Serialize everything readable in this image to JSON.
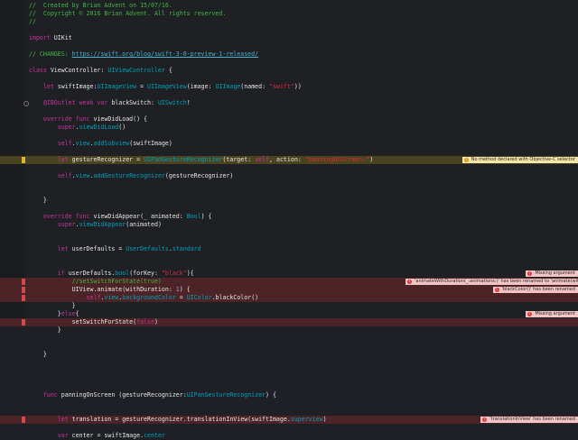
{
  "editor": {
    "lines": [
      {
        "parts": [
          {
            "c": "c",
            "t": "//  Created by Brian Advent on 15/07/16."
          }
        ]
      },
      {
        "parts": [
          {
            "c": "c",
            "t": "//  Copyright © 2016 Brian Advent. All rights reserved."
          }
        ]
      },
      {
        "parts": [
          {
            "c": "c",
            "t": "//"
          }
        ]
      },
      {
        "parts": []
      },
      {
        "parts": [
          {
            "c": "k",
            "t": "import"
          },
          {
            "c": "w",
            "t": " UIKit"
          }
        ]
      },
      {
        "parts": []
      },
      {
        "parts": [
          {
            "c": "c",
            "t": "// CHANGES: "
          },
          {
            "c": "lnk",
            "t": "https://swift.org/blog/swift-3-0-preview-1-released/"
          }
        ]
      },
      {
        "parts": []
      },
      {
        "parts": [
          {
            "c": "k",
            "t": "class"
          },
          {
            "c": "w",
            "t": " ViewController: "
          },
          {
            "c": "t",
            "t": "UIViewController"
          },
          {
            "c": "w",
            "t": " {"
          }
        ]
      },
      {
        "parts": []
      },
      {
        "parts": [
          {
            "c": "w",
            "t": "    "
          },
          {
            "c": "k",
            "t": "let"
          },
          {
            "c": "w",
            "t": " swiftImage:"
          },
          {
            "c": "t",
            "t": "UIImageView"
          },
          {
            "c": "w",
            "t": " = "
          },
          {
            "c": "t",
            "t": "UIImageView"
          },
          {
            "c": "w",
            "t": "(image: "
          },
          {
            "c": "t",
            "t": "UIImage"
          },
          {
            "c": "w",
            "t": "(named: "
          },
          {
            "c": "s",
            "t": "\"swift\""
          },
          {
            "c": "w",
            "t": "))"
          }
        ]
      },
      {
        "parts": []
      },
      {
        "parts": [
          {
            "c": "w",
            "t": "    "
          },
          {
            "c": "k",
            "t": "@IBOutlet weak var"
          },
          {
            "c": "w",
            "t": " blackSwitch: "
          },
          {
            "c": "t",
            "t": "UISwitch"
          },
          {
            "c": "w",
            "t": "!"
          }
        ],
        "dot": true
      },
      {
        "parts": []
      },
      {
        "parts": [
          {
            "c": "w",
            "t": "    "
          },
          {
            "c": "k",
            "t": "override func"
          },
          {
            "c": "w",
            "t": " viewDidLoad() {"
          }
        ]
      },
      {
        "parts": [
          {
            "c": "w",
            "t": "        "
          },
          {
            "c": "k",
            "t": "super"
          },
          {
            "c": "w",
            "t": "."
          },
          {
            "c": "t",
            "t": "viewDidLoad"
          },
          {
            "c": "w",
            "t": "()"
          }
        ]
      },
      {
        "parts": []
      },
      {
        "parts": [
          {
            "c": "w",
            "t": "        "
          },
          {
            "c": "k",
            "t": "self"
          },
          {
            "c": "w",
            "t": "."
          },
          {
            "c": "t",
            "t": "view"
          },
          {
            "c": "w",
            "t": "."
          },
          {
            "c": "t",
            "t": "addSubview"
          },
          {
            "c": "w",
            "t": "(swiftImage)"
          }
        ]
      },
      {
        "parts": []
      },
      {
        "parts": [
          {
            "c": "w",
            "t": "        "
          },
          {
            "c": "k",
            "t": "let"
          },
          {
            "c": "w",
            "t": " gestureRecognizer = "
          },
          {
            "c": "t",
            "t": "UIPanGestureRecognizer"
          },
          {
            "c": "w",
            "t": "(target: "
          },
          {
            "c": "k",
            "t": "self"
          },
          {
            "c": "w",
            "t": ", action: "
          },
          {
            "c": "s",
            "t": "\"panningOnScreen:\""
          },
          {
            "c": "w",
            "t": ")"
          }
        ],
        "hl": "warn",
        "marker": "warn"
      },
      {
        "parts": []
      },
      {
        "parts": [
          {
            "c": "w",
            "t": "        "
          },
          {
            "c": "k",
            "t": "self"
          },
          {
            "c": "w",
            "t": "."
          },
          {
            "c": "t",
            "t": "view"
          },
          {
            "c": "w",
            "t": "."
          },
          {
            "c": "t",
            "t": "addGestureRecognizer"
          },
          {
            "c": "w",
            "t": "(gestureRecognizer)"
          }
        ]
      },
      {
        "parts": []
      },
      {
        "parts": []
      },
      {
        "parts": [
          {
            "c": "w",
            "t": "    }"
          }
        ]
      },
      {
        "parts": []
      },
      {
        "parts": [
          {
            "c": "w",
            "t": "    "
          },
          {
            "c": "k",
            "t": "override func"
          },
          {
            "c": "w",
            "t": " viewDidAppear(_ animated: "
          },
          {
            "c": "t",
            "t": "Bool"
          },
          {
            "c": "w",
            "t": ") {"
          }
        ]
      },
      {
        "parts": [
          {
            "c": "w",
            "t": "        "
          },
          {
            "c": "k",
            "t": "super"
          },
          {
            "c": "w",
            "t": "."
          },
          {
            "c": "t",
            "t": "viewDidAppear"
          },
          {
            "c": "w",
            "t": "(animated)"
          }
        ]
      },
      {
        "parts": []
      },
      {
        "parts": []
      },
      {
        "parts": [
          {
            "c": "w",
            "t": "        "
          },
          {
            "c": "k",
            "t": "let"
          },
          {
            "c": "w",
            "t": " userDefaults = "
          },
          {
            "c": "t",
            "t": "UserDefaults"
          },
          {
            "c": "w",
            "t": "."
          },
          {
            "c": "t",
            "t": "standard"
          }
        ]
      },
      {
        "parts": []
      },
      {
        "parts": []
      },
      {
        "parts": [
          {
            "c": "w",
            "t": "        "
          },
          {
            "c": "k",
            "t": "if"
          },
          {
            "c": "w",
            "t": " userDefaults."
          },
          {
            "c": "t",
            "t": "bool"
          },
          {
            "c": "w",
            "t": "(forKey: "
          },
          {
            "c": "s",
            "t": "\"black\""
          },
          {
            "c": "w",
            "t": "){"
          }
        ]
      },
      {
        "parts": [
          {
            "c": "c",
            "t": "            //setSwitchForState(true)"
          }
        ],
        "hl": "err",
        "marker": "err"
      },
      {
        "parts": [
          {
            "c": "w",
            "t": "            UIView.animate(withDuration: "
          },
          {
            "c": "m",
            "t": "1"
          },
          {
            "c": "w",
            "t": ") {"
          }
        ],
        "hl": "err",
        "marker": "err"
      },
      {
        "parts": [
          {
            "c": "w",
            "t": "                "
          },
          {
            "c": "k",
            "t": "self"
          },
          {
            "c": "w",
            "t": "."
          },
          {
            "c": "t",
            "t": "view"
          },
          {
            "c": "w",
            "t": "."
          },
          {
            "c": "t",
            "t": "backgroundColor"
          },
          {
            "c": "w",
            "t": " = "
          },
          {
            "c": "t",
            "t": "UIColor"
          },
          {
            "c": "w",
            "t": ".blackColor()"
          }
        ],
        "hl": "err",
        "marker": "err"
      },
      {
        "parts": [
          {
            "c": "w",
            "t": "            }"
          }
        ]
      },
      {
        "parts": [
          {
            "c": "w",
            "t": "        }"
          },
          {
            "c": "k",
            "t": "else"
          },
          {
            "c": "w",
            "t": "{"
          }
        ]
      },
      {
        "parts": [
          {
            "c": "w",
            "t": "            setSwitchForState("
          },
          {
            "c": "k",
            "t": "false"
          },
          {
            "c": "w",
            "t": ")"
          }
        ],
        "hl": "err",
        "marker": "err"
      },
      {
        "parts": [
          {
            "c": "w",
            "t": "        }"
          }
        ]
      },
      {
        "parts": []
      },
      {
        "parts": []
      },
      {
        "parts": [
          {
            "c": "w",
            "t": "    }"
          }
        ]
      },
      {
        "parts": []
      },
      {
        "parts": []
      },
      {
        "parts": []
      },
      {
        "parts": []
      },
      {
        "parts": [
          {
            "c": "w",
            "t": "    "
          },
          {
            "c": "k",
            "t": "func"
          },
          {
            "c": "w",
            "t": " panningOnScreen (gestureRecognizer:"
          },
          {
            "c": "t",
            "t": "UIPanGestureRecognizer"
          },
          {
            "c": "w",
            "t": ") {"
          }
        ]
      },
      {
        "parts": []
      },
      {
        "parts": []
      },
      {
        "parts": [
          {
            "c": "w",
            "t": "        "
          },
          {
            "c": "k",
            "t": "let"
          },
          {
            "c": "w",
            "t": " translation = gestureRecognizer.translationInView(swiftImage."
          },
          {
            "c": "t",
            "t": "superview"
          },
          {
            "c": "w",
            "t": ")"
          }
        ],
        "hl": "err",
        "marker": "err"
      },
      {
        "parts": []
      },
      {
        "parts": [
          {
            "c": "w",
            "t": "        "
          },
          {
            "c": "k",
            "t": "var"
          },
          {
            "c": "w",
            "t": " center = swiftImage."
          },
          {
            "c": "t",
            "t": "center"
          }
        ]
      }
    ]
  },
  "issues": [
    {
      "line": 19,
      "type": "warn",
      "text": "No method declared with Objective-C selector"
    },
    {
      "line": 33,
      "type": "err",
      "text": "Missing argument"
    },
    {
      "line": 34,
      "type": "err",
      "text": "'animateWithDuration(_:animations:)' has been renamed to 'animate(withDuration:animations:)'"
    },
    {
      "line": 35,
      "type": "err",
      "text": "'blackColor()' has been renamed"
    },
    {
      "line": 38,
      "type": "err",
      "text": "Missing argument"
    },
    {
      "line": 51,
      "type": "err",
      "text": "'translationInView' has been renamed"
    }
  ],
  "colors": {
    "background": "#1f2024",
    "comment": "#41b645",
    "keyword": "#c2349b",
    "type": "#00a0be",
    "string": "#db2c38",
    "warning": "#e0b437",
    "error": "#d04a4a"
  }
}
